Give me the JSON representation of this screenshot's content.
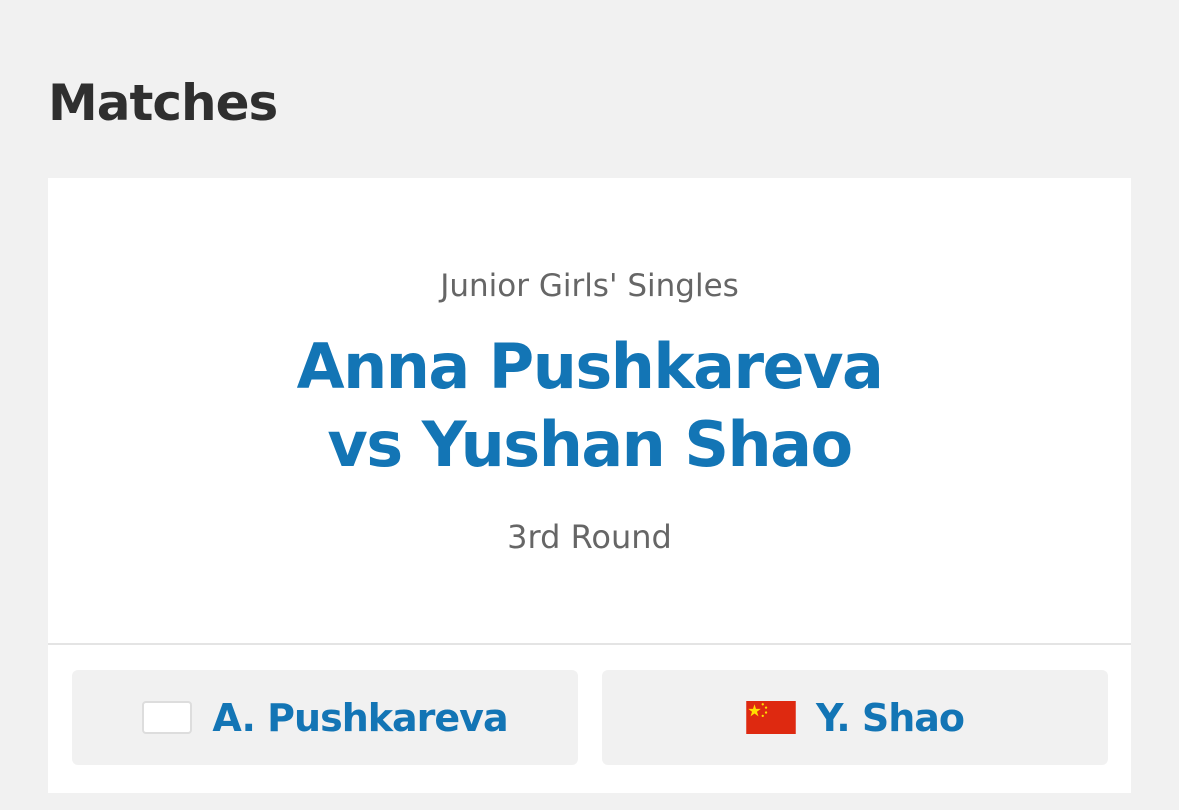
{
  "page": {
    "title": "Matches"
  },
  "match": {
    "event": "Junior Girls' Singles",
    "title_line1": "Anna Pushkareva",
    "title_line2": "vs Yushan Shao",
    "round": "3rd Round",
    "players": [
      {
        "short_name": "A. Pushkareva",
        "flag": "blank-flag-icon"
      },
      {
        "short_name": "Y. Shao",
        "flag": "china-flag-icon"
      }
    ]
  },
  "colors": {
    "accent": "#1375b5",
    "background": "#f1f1f1",
    "card": "#ffffff",
    "heading": "#2f2f2f",
    "muted_text": "#666666",
    "flag_red": "#de2910",
    "flag_yellow": "#ffde00"
  }
}
